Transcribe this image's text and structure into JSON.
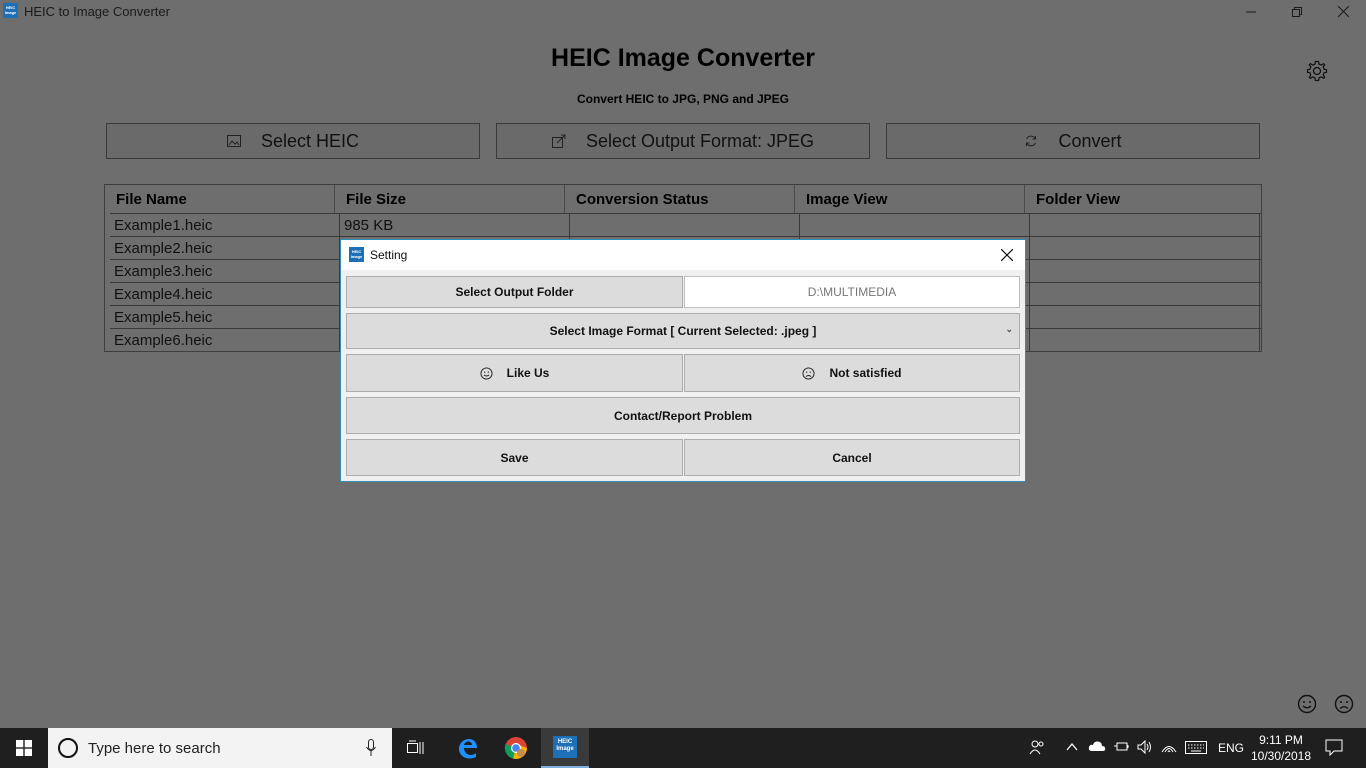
{
  "window": {
    "title": "HEIC to Image Converter",
    "app_icon_text": "HEIC Image"
  },
  "main": {
    "title": "HEIC Image Converter",
    "subtitle": "Convert HEIC to JPG, PNG and JPEG",
    "buttons": {
      "select_heic": "Select HEIC",
      "select_output": "Select Output Format: JPEG",
      "convert": "Convert"
    }
  },
  "table": {
    "columns": [
      "File Name",
      "File Size",
      "Conversion Status",
      "Image View",
      "Folder View"
    ],
    "rows": [
      {
        "name": "Example1.heic",
        "size": "985 KB"
      },
      {
        "name": "Example2.heic",
        "size": ""
      },
      {
        "name": "Example3.heic",
        "size": ""
      },
      {
        "name": "Example4.heic",
        "size": ""
      },
      {
        "name": "Example5.heic",
        "size": ""
      },
      {
        "name": "Example6.heic",
        "size": ""
      }
    ]
  },
  "dialog": {
    "title": "Setting",
    "select_output_folder": "Select Output Folder",
    "output_folder_value": "D:\\MULTIMEDIA",
    "image_format": "Select Image Format [ Current Selected: .jpeg ]",
    "like_us": "Like Us",
    "not_satisfied": "Not satisfied",
    "contact": "Contact/Report Problem",
    "save": "Save",
    "cancel": "Cancel"
  },
  "taskbar": {
    "search_placeholder": "Type here to search",
    "language": "ENG",
    "time": "9:11 PM",
    "date": "10/30/2018"
  },
  "icons": {
    "start": "windows-logo-icon",
    "task_view": "task-view-icon",
    "edge": "edge-icon",
    "chrome": "chrome-icon",
    "app": "heic-app-icon",
    "settings": "gear-icon"
  },
  "colors": {
    "overlay_bg": "#6e6e6e",
    "dialog_border": "#2f8fb8",
    "app_icon": "#1e6fb5",
    "taskbar": "#1f1f1f"
  }
}
